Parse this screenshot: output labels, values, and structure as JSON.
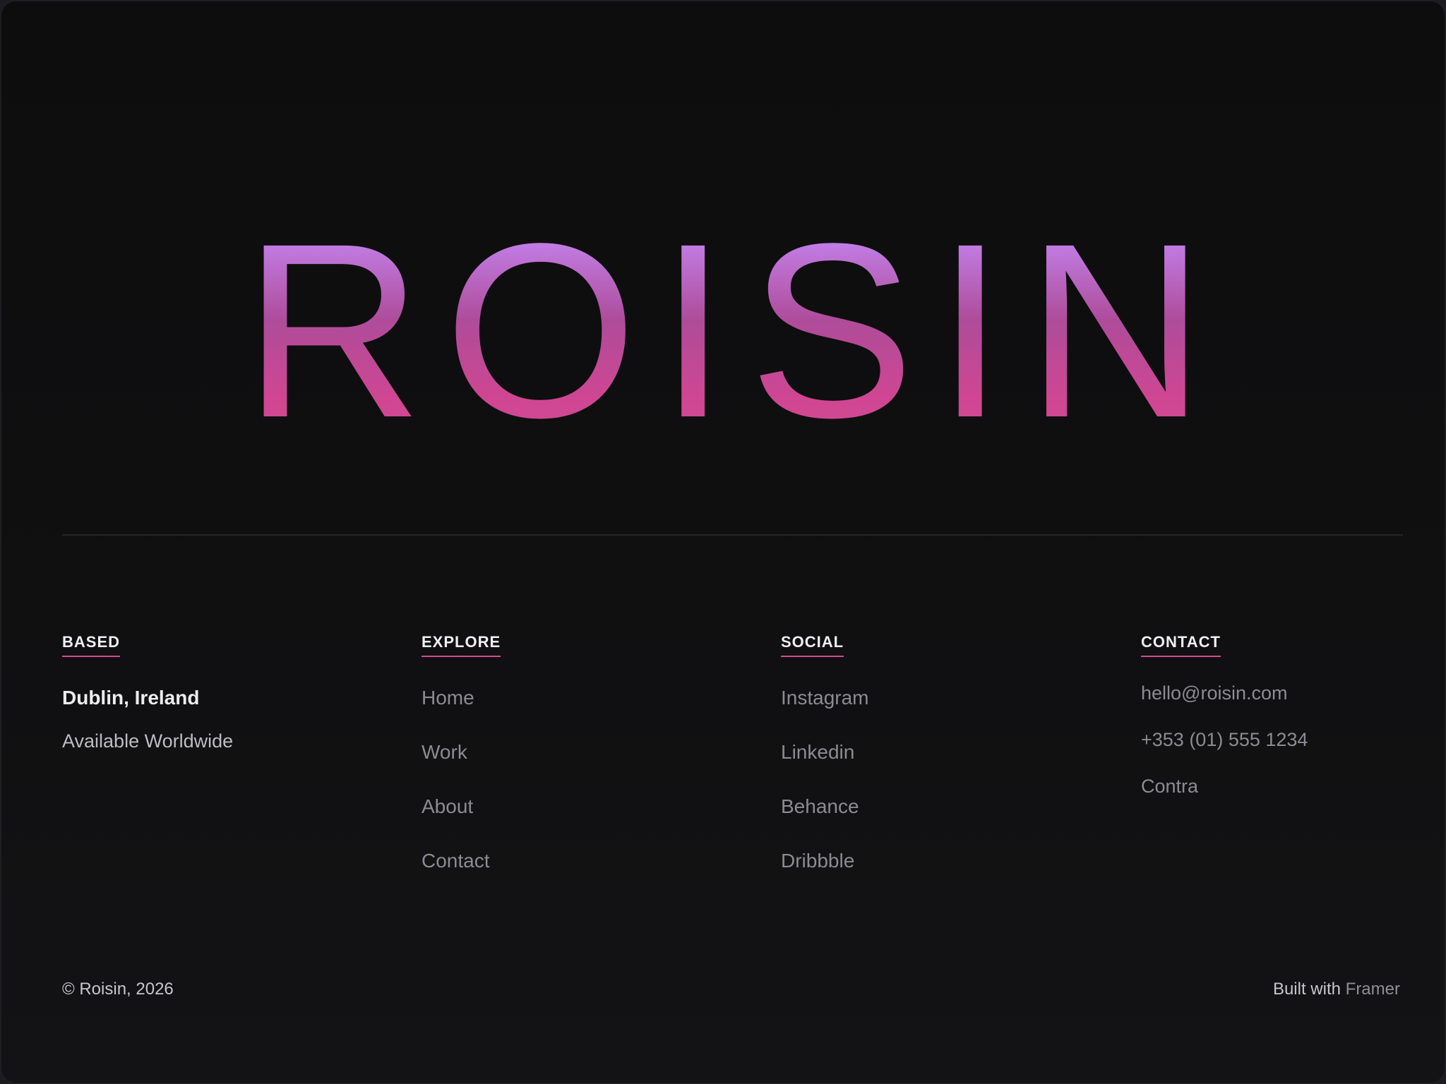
{
  "hero": {
    "title": "ROISIN"
  },
  "colors": {
    "accent": "#d24b93",
    "gradient_top": "#c084f5",
    "gradient_bottom": "#d24b93",
    "background": "#0f0f10"
  },
  "footer_columns": {
    "based": {
      "heading": "BASED",
      "location": "Dublin, Ireland",
      "availability": "Available Worldwide"
    },
    "explore": {
      "heading": "EXPLORE",
      "links": [
        "Home",
        "Work",
        "About",
        "Contact"
      ]
    },
    "social": {
      "heading": "SOCIAL",
      "links": [
        "Instagram",
        "Linkedin",
        "Behance",
        "Dribbble"
      ]
    },
    "contact": {
      "heading": "CONTACT",
      "email": "hello@roisin.com",
      "phone": "+353 (01) 555 1234",
      "platform": "Contra"
    }
  },
  "bottom_bar": {
    "copyright": "© Roisin, 2026",
    "built_with_prefix": "Built with",
    "built_with_link": "Framer"
  }
}
